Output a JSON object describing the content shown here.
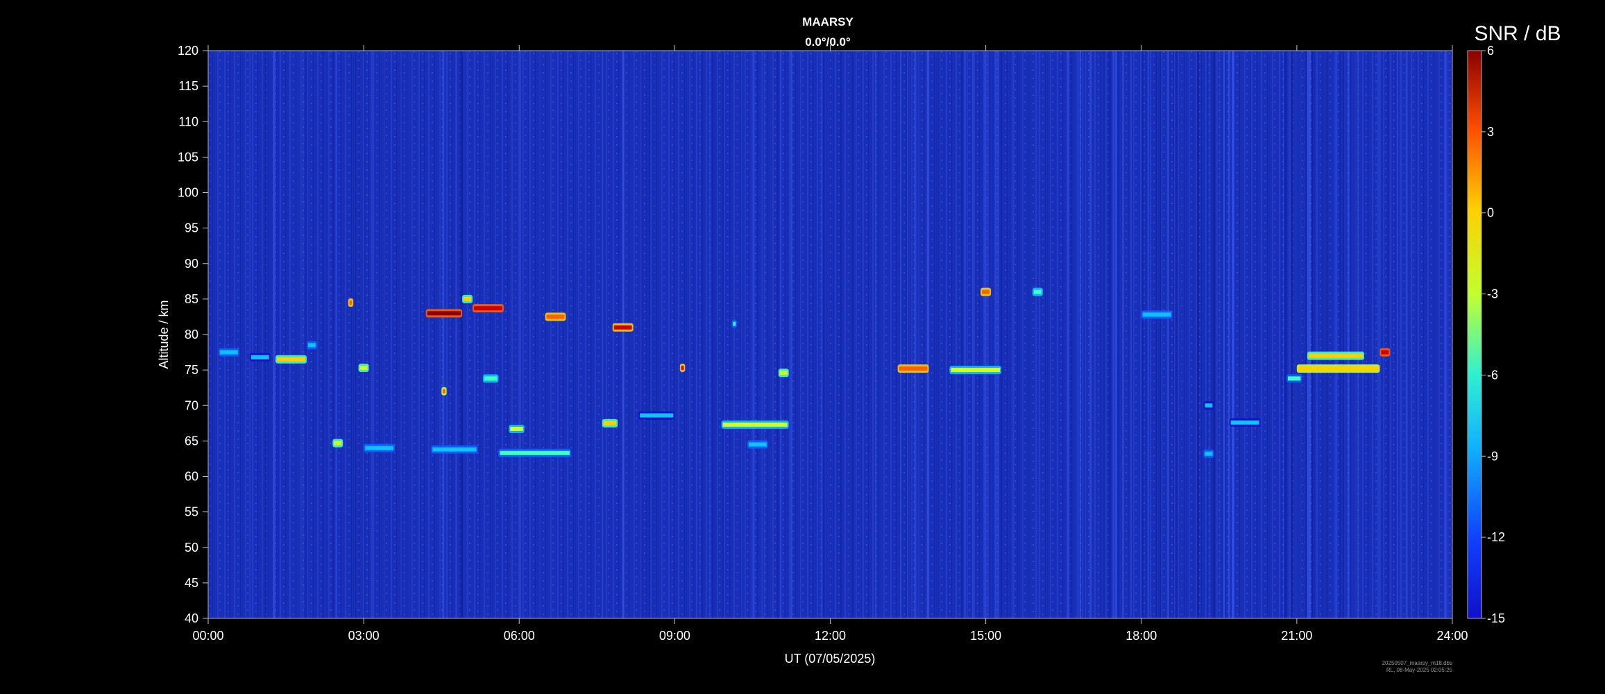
{
  "chart_data": {
    "type": "heatmap",
    "title": "MAARSY",
    "subtitle": "0.0°/0.0°",
    "xlabel": "UT (07/05/2025)",
    "ylabel": "Altitude / km",
    "x_range": [
      "00:00",
      "24:00"
    ],
    "x_ticks": [
      "00:00",
      "03:00",
      "06:00",
      "09:00",
      "12:00",
      "15:00",
      "18:00",
      "21:00",
      "24:00"
    ],
    "ylim": [
      40,
      120
    ],
    "y_ticks": [
      "40",
      "45",
      "50",
      "55",
      "60",
      "65",
      "70",
      "75",
      "80",
      "85",
      "90",
      "95",
      "100",
      "105",
      "110",
      "115",
      "120"
    ],
    "colorbar": {
      "label": "SNR / dB",
      "range": [
        -15,
        6
      ],
      "ticks": [
        "6",
        "3",
        "0",
        "-3",
        "-6",
        "-9",
        "-12",
        "-15"
      ],
      "colors": [
        "#1010c8",
        "#1060ff",
        "#10c0ff",
        "#40ffc0",
        "#d0ff20",
        "#ffd000",
        "#ff6000",
        "#d00000",
        "#900000"
      ]
    },
    "background_color": "#1a2fb8",
    "echoes": [
      {
        "t": 0.2,
        "t2": 0.6,
        "alt": 77.5,
        "snr": -9
      },
      {
        "t": 0.8,
        "t2": 1.2,
        "alt": 76.8,
        "snr": -10
      },
      {
        "t": 1.3,
        "t2": 1.9,
        "alt": 76.5,
        "snr": -2
      },
      {
        "t": 1.9,
        "t2": 2.1,
        "alt": 78.5,
        "snr": -9
      },
      {
        "t": 2.7,
        "t2": 2.8,
        "alt": 84.5,
        "snr": 2
      },
      {
        "t": 2.9,
        "t2": 3.1,
        "alt": 75.3,
        "snr": -4
      },
      {
        "t": 4.2,
        "t2": 4.9,
        "alt": 83.0,
        "snr": 5
      },
      {
        "t": 5.1,
        "t2": 5.7,
        "alt": 83.7,
        "snr": 4
      },
      {
        "t": 6.5,
        "t2": 6.9,
        "alt": 82.5,
        "snr": 1
      },
      {
        "t": 7.8,
        "t2": 8.2,
        "alt": 81.0,
        "snr": 3
      },
      {
        "t": 10.1,
        "t2": 10.2,
        "alt": 81.5,
        "snr": -8
      },
      {
        "t": 4.9,
        "t2": 5.1,
        "alt": 85.0,
        "snr": -3
      },
      {
        "t": 4.5,
        "t2": 4.6,
        "alt": 72.0,
        "snr": 0
      },
      {
        "t": 5.3,
        "t2": 5.6,
        "alt": 73.8,
        "snr": -6
      },
      {
        "t": 9.1,
        "t2": 9.2,
        "alt": 75.3,
        "snr": 3
      },
      {
        "t": 11.0,
        "t2": 11.2,
        "alt": 74.6,
        "snr": -4
      },
      {
        "t": 13.3,
        "t2": 13.9,
        "alt": 75.2,
        "snr": 1
      },
      {
        "t": 14.3,
        "t2": 15.3,
        "alt": 75.0,
        "snr": -5
      },
      {
        "t": 14.9,
        "t2": 15.1,
        "alt": 86.0,
        "snr": 2
      },
      {
        "t": 15.9,
        "t2": 16.1,
        "alt": 86.0,
        "snr": -6
      },
      {
        "t": 18.0,
        "t2": 18.6,
        "alt": 82.8,
        "snr": -9
      },
      {
        "t": 2.4,
        "t2": 2.6,
        "alt": 64.7,
        "snr": -4
      },
      {
        "t": 3.0,
        "t2": 3.6,
        "alt": 64.0,
        "snr": -9
      },
      {
        "t": 4.3,
        "t2": 5.2,
        "alt": 63.8,
        "snr": -9
      },
      {
        "t": 5.6,
        "t2": 7.0,
        "alt": 63.3,
        "snr": -8
      },
      {
        "t": 5.8,
        "t2": 6.1,
        "alt": 66.7,
        "snr": -5
      },
      {
        "t": 7.6,
        "t2": 7.9,
        "alt": 67.5,
        "snr": -2
      },
      {
        "t": 8.3,
        "t2": 9.0,
        "alt": 68.6,
        "snr": -10
      },
      {
        "t": 9.9,
        "t2": 11.2,
        "alt": 67.3,
        "snr": -5
      },
      {
        "t": 10.4,
        "t2": 10.8,
        "alt": 64.5,
        "snr": -9
      },
      {
        "t": 21.2,
        "t2": 22.3,
        "alt": 77.0,
        "snr": -2
      },
      {
        "t": 21.0,
        "t2": 22.6,
        "alt": 75.2,
        "snr": -1
      },
      {
        "t": 22.6,
        "t2": 22.8,
        "alt": 77.5,
        "snr": 4
      },
      {
        "t": 20.8,
        "t2": 21.1,
        "alt": 73.8,
        "snr": -8
      },
      {
        "t": 19.2,
        "t2": 19.4,
        "alt": 70.0,
        "snr": -10
      },
      {
        "t": 19.7,
        "t2": 20.3,
        "alt": 67.6,
        "snr": -10
      },
      {
        "t": 19.2,
        "t2": 19.4,
        "alt": 63.2,
        "snr": -9
      }
    ]
  },
  "footnote": {
    "line1": "20250507_maarsy_m18.dbs",
    "line2": "RL, 08-May-2025 02:05:25"
  }
}
